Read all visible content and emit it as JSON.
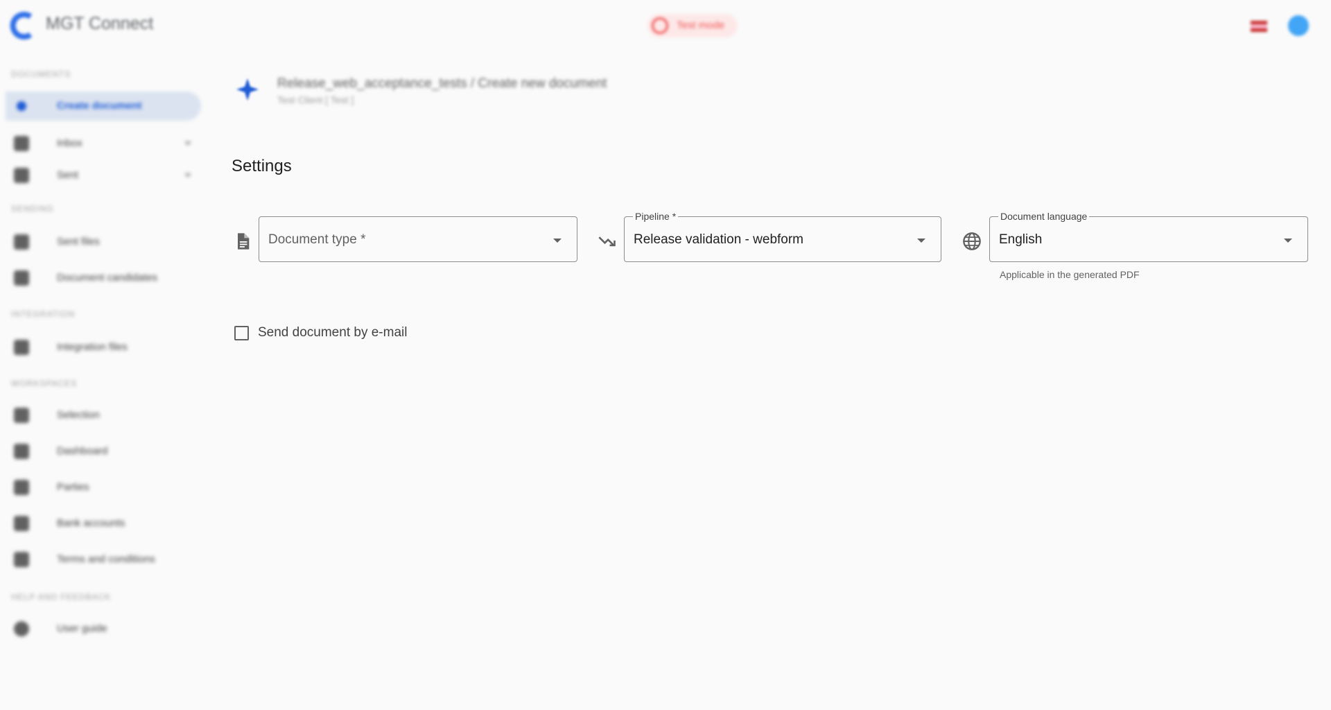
{
  "app": {
    "title": "MGT Connect",
    "test_mode_label": "Test mode"
  },
  "sidebar": {
    "sections": [
      {
        "label": "DOCUMENTS"
      },
      {
        "label": "SENDING"
      },
      {
        "label": "INTEGRATION"
      },
      {
        "label": "WORKSPACES"
      },
      {
        "label": "HELP AND FEEDBACK"
      }
    ],
    "items": [
      {
        "label": "Create document",
        "icon": "plus-icon",
        "active": true
      },
      {
        "label": "Inbox",
        "icon": "inbox-icon",
        "expandable": true
      },
      {
        "label": "Sent",
        "icon": "send-icon",
        "expandable": true
      },
      {
        "label": "Sent files",
        "icon": "file-icon"
      },
      {
        "label": "Document candidates",
        "icon": "documents-icon"
      },
      {
        "label": "Integration files",
        "icon": "integration-icon"
      },
      {
        "label": "Selection",
        "icon": "selection-icon"
      },
      {
        "label": "Dashboard",
        "icon": "dashboard-icon"
      },
      {
        "label": "Parties",
        "icon": "parties-icon"
      },
      {
        "label": "Bank accounts",
        "icon": "bank-icon"
      },
      {
        "label": "Terms and conditions",
        "icon": "terms-icon"
      },
      {
        "label": "User guide",
        "icon": "help-icon"
      }
    ]
  },
  "header": {
    "breadcrumb": "Release_web_acceptance_tests / Create new document",
    "subtitle": "Test Client [ Test ]"
  },
  "form": {
    "section_title": "Settings",
    "document_type": {
      "placeholder": "Document type *",
      "value": ""
    },
    "pipeline": {
      "label": "Pipeline *",
      "value": "Release validation - webform"
    },
    "language": {
      "label": "Document language",
      "value": "English",
      "helper": "Applicable in the generated PDF"
    },
    "send_email": {
      "label": "Send document by e-mail",
      "checked": false
    }
  },
  "colors": {
    "accent": "#1e5bd6",
    "active_nav_bg": "#dbe3f0",
    "test_mode": "#ef5350"
  }
}
